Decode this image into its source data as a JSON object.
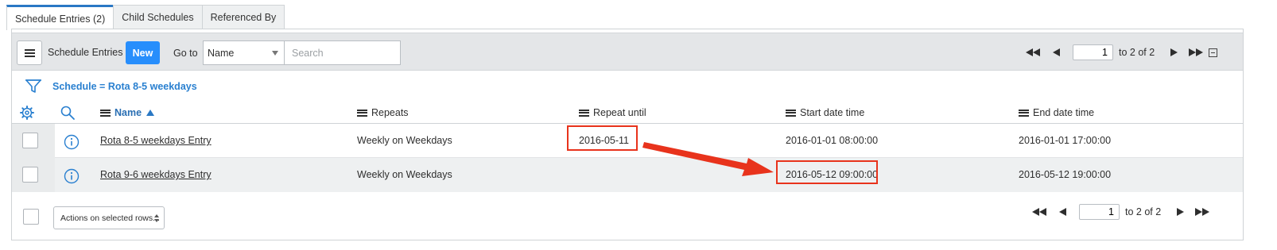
{
  "tabs": [
    {
      "label": "Schedule Entries (2)",
      "active": true
    },
    {
      "label": "Child Schedules",
      "active": false
    },
    {
      "label": "Referenced By",
      "active": false
    }
  ],
  "toolbar": {
    "title": "Schedule Entries",
    "new_label": "New",
    "goto_label": "Go to",
    "goto_field": "Name",
    "search_placeholder": "Search",
    "page_current": "1",
    "page_of": "to 2 of 2"
  },
  "breadcrumb": {
    "filter_text": "Schedule = Rota 8-5 weekdays"
  },
  "table": {
    "columns": [
      "Name",
      "Repeats",
      "Repeat until",
      "Start date time",
      "End date time"
    ],
    "sort": {
      "column": "Name",
      "direction": "ascending"
    },
    "rows": [
      {
        "name": "Rota 8-5 weekdays Entry",
        "repeats": "Weekly on Weekdays",
        "repeat_until": "2016-05-11",
        "start": "2016-01-01 08:00:00",
        "end": "2016-01-01 17:00:00"
      },
      {
        "name": "Rota 9-6 weekdays Entry",
        "repeats": "Weekly on Weekdays",
        "repeat_until": "",
        "start": "2016-05-12 09:00:00",
        "end": "2016-05-12 19:00:00"
      }
    ]
  },
  "footer": {
    "actions_label": "Actions on selected rows...",
    "page_current": "1",
    "page_of": "to 2 of 2"
  },
  "colors": {
    "accent": "#278efc",
    "link": "#2a80d0",
    "highlight": "#e8331c"
  },
  "icons": [
    "hamburger-icon",
    "first-page-icon",
    "prev-page-icon",
    "next-page-icon",
    "last-page-icon",
    "collapse-icon",
    "filter-icon",
    "gear-icon",
    "search-icon",
    "info-icon",
    "sort-ascending-icon"
  ]
}
